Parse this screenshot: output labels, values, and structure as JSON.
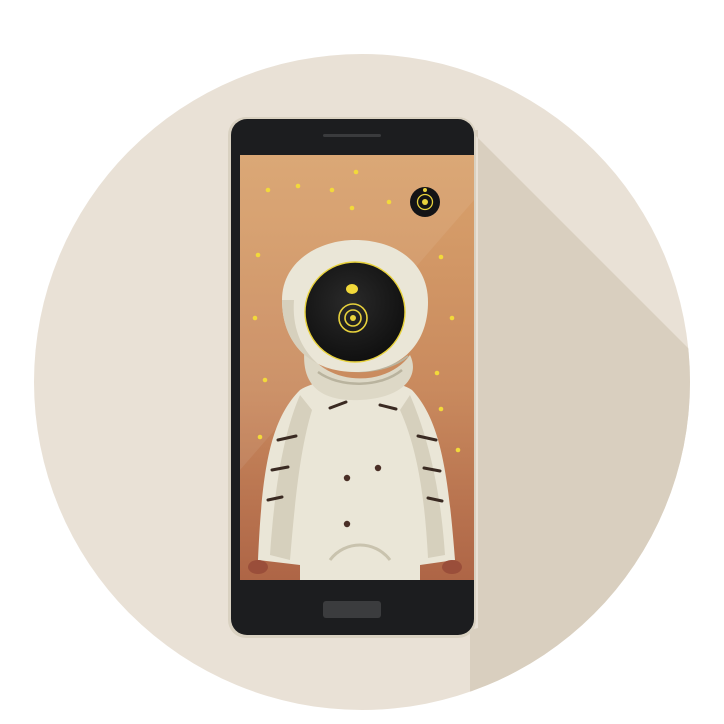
{
  "illustration": {
    "subject": "smartphone-with-hooded-figure",
    "colors": {
      "circle": "#E9E1D6",
      "circle_shadow": "#D8CEBE",
      "phone_body": "#1C1D1F",
      "phone_rim": "#D9D1C1",
      "screen_top": "#D9A06A",
      "screen_bottom": "#B26A48",
      "robe": "#EAE6D7",
      "robe_shade": "#C9C3AE",
      "lens_ring": "#E8D23C",
      "stars": "#F2D93A"
    },
    "icons": [
      "front-camera-icon",
      "home-button-icon",
      "speaker-grille-icon"
    ]
  }
}
